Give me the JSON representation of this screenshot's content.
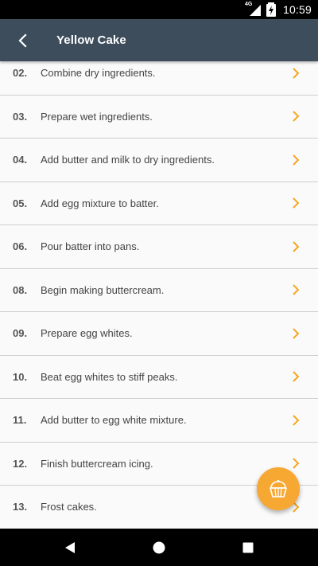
{
  "status_bar": {
    "network": "4G",
    "time": "10:59",
    "icons": [
      "signal-icon",
      "battery-charging-icon"
    ]
  },
  "app_bar": {
    "title": "Yellow Cake",
    "back_icon": "arrow-back-icon"
  },
  "steps": [
    {
      "number": "02.",
      "text": "Combine dry ingredients."
    },
    {
      "number": "03.",
      "text": "Prepare wet ingredients."
    },
    {
      "number": "04.",
      "text": "Add butter and milk to dry ingredients."
    },
    {
      "number": "05.",
      "text": "Add egg mixture to batter."
    },
    {
      "number": "06.",
      "text": "Pour batter into pans."
    },
    {
      "number": "08.",
      "text": "Begin making buttercream."
    },
    {
      "number": "09.",
      "text": "Prepare egg whites."
    },
    {
      "number": "10.",
      "text": "Beat egg whites to stiff peaks."
    },
    {
      "number": "11.",
      "text": "Add butter to egg white mixture."
    },
    {
      "number": "12.",
      "text": "Finish buttercream icing."
    },
    {
      "number": "13.",
      "text": "Frost cakes."
    }
  ],
  "fab": {
    "icon": "cupcake-icon"
  },
  "nav_bar": {
    "icons": [
      "nav-back-icon",
      "nav-home-icon",
      "nav-recents-icon"
    ]
  },
  "colors": {
    "app_bar": "#3d4d5c",
    "accent": "#f7a833",
    "chevron": "#f5a623",
    "background": "#fafafa",
    "divider": "#cfcfcf"
  }
}
